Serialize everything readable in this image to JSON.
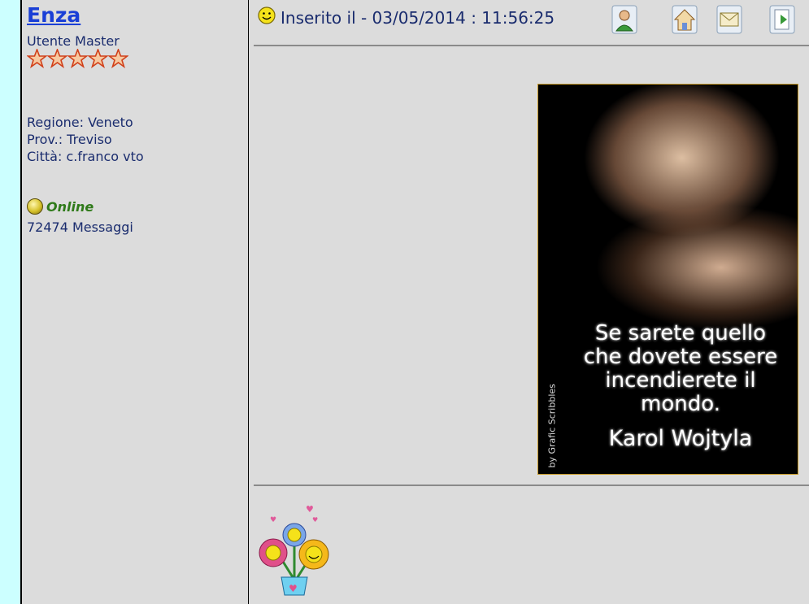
{
  "user": {
    "name": "Enza",
    "rank": "Utente Master",
    "stars": 5,
    "region": "Regione: Veneto",
    "province": "Prov.: Treviso",
    "city": "Città: c.franco vto",
    "status": "Online",
    "messages": "72474 Messaggi"
  },
  "post": {
    "posted_label": "Inserito il - 03/05/2014 : 11:56:25",
    "icons": [
      "profile-icon",
      "home-icon",
      "email-icon",
      "quote-icon"
    ],
    "image": {
      "quote": "Se sarete quello\nche dovete essere\nincendierete il\nmondo.",
      "author": "Karol Wojtyla",
      "credit": "by Grafic Scribbles"
    }
  },
  "colors": {
    "background": "#ccffff",
    "panel": "#dcdcdc",
    "link": "#1a3fd6",
    "text": "#1a2c6e",
    "online": "#2f7a1a",
    "star": "#e05020"
  }
}
